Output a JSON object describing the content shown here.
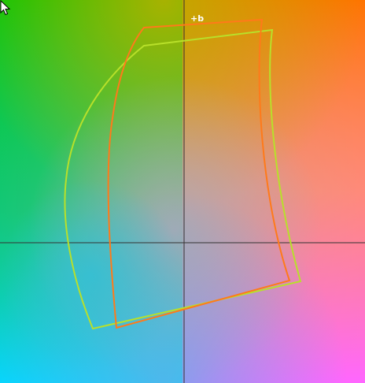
{
  "diagram": {
    "axis_label_b": "+b",
    "colors": {
      "axis": "#333333",
      "axis_label": "#ffffff",
      "gamut_outer": "#b8e02a",
      "gamut_inner": "#ff7a1a"
    },
    "background_hues": {
      "green": "#00c800",
      "yellow_green": "#8cc400",
      "orange": "#ff7a00",
      "cyan": "#00d8f0",
      "light_blue": "#00c0ff",
      "magenta": "#ff6cff",
      "pink": "#ff8cc8",
      "center_gray": "#a0a8a0"
    },
    "icons": {
      "cursor": "mouse-pointer-icon"
    }
  }
}
